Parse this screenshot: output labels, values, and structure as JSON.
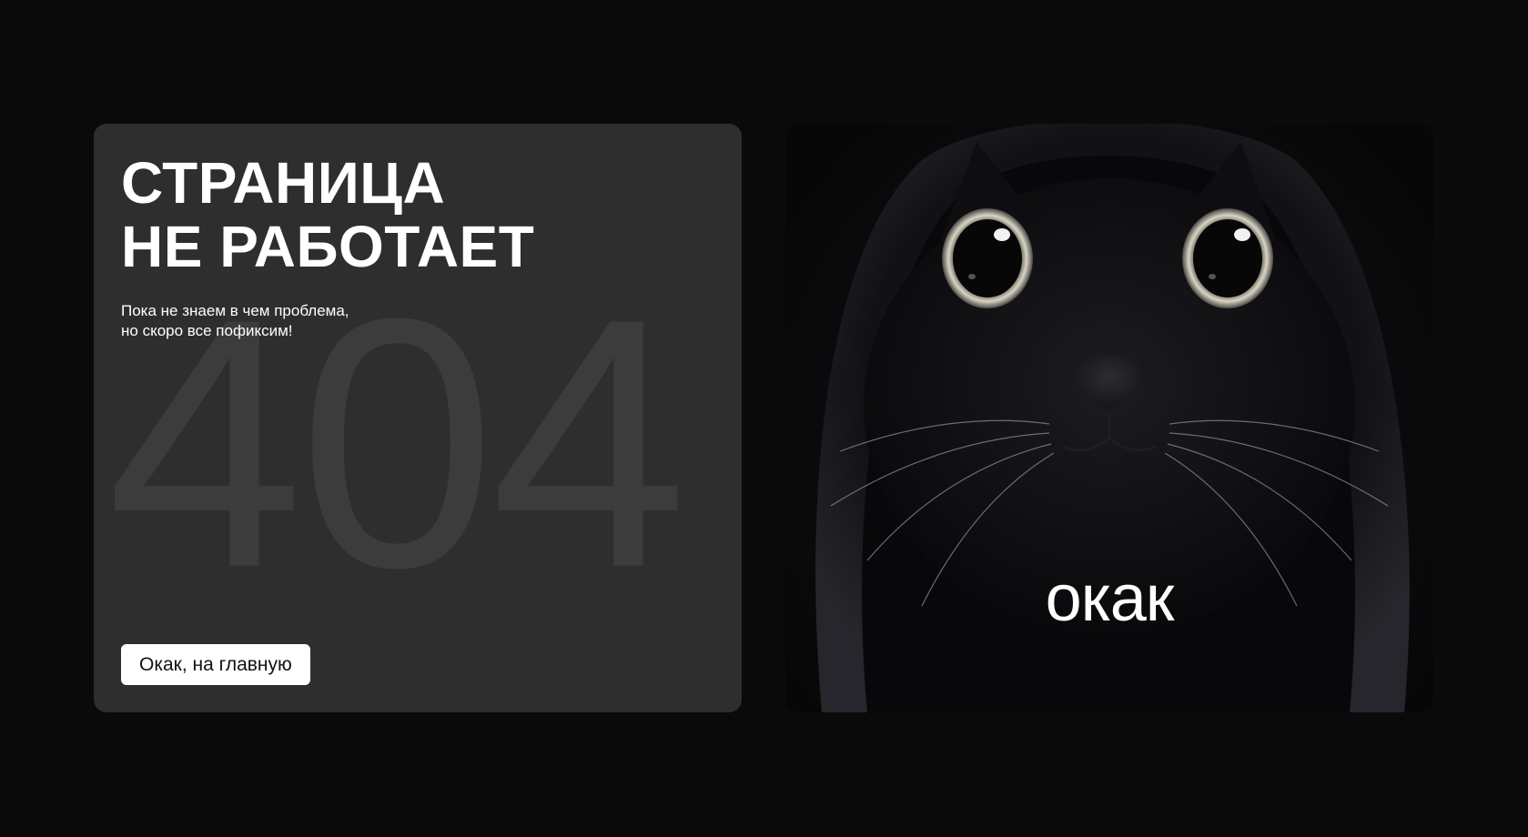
{
  "error_card": {
    "code": "404",
    "title_line1": "СТРАНИЦА",
    "title_line2": "НЕ РАБОТАЕТ",
    "subtitle_line1": "Пока не знаем в чем проблема,",
    "subtitle_line2": "но скоро все пофиксим!",
    "home_button_label": "Окак, на главную"
  },
  "image_card": {
    "caption": "окак",
    "image_subject": "black-cat-in-hood"
  },
  "colors": {
    "page_background": "#0a0a0a",
    "card_background": "#2e2e2e",
    "watermark_404": "#3c3c3c",
    "text": "#ffffff",
    "button_background": "#ffffff",
    "button_text": "#111111"
  }
}
